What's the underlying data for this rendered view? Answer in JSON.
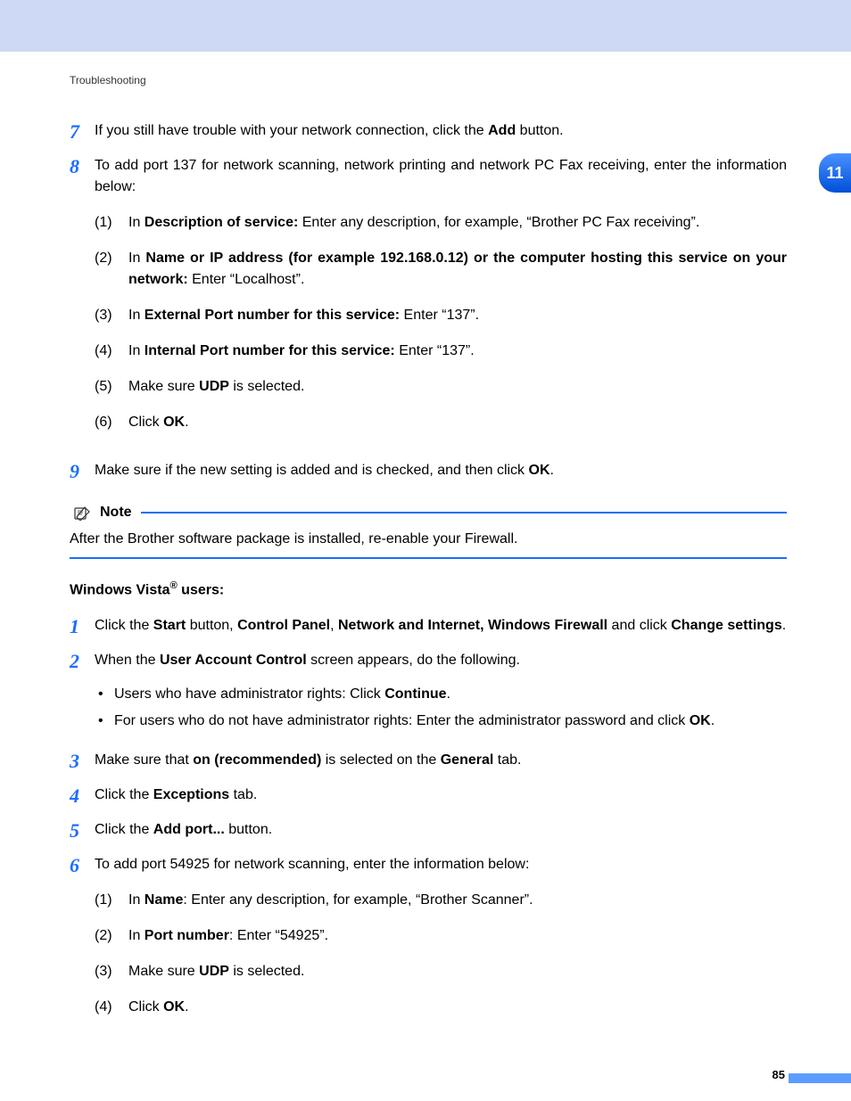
{
  "header": {
    "section": "Troubleshooting"
  },
  "chapter": {
    "number": "11"
  },
  "page": {
    "number": "85"
  },
  "steps7to9": {
    "s7": {
      "num": "7",
      "pre": "If you still have trouble with your network connection, click the ",
      "b1": "Add",
      "post": " button."
    },
    "s8": {
      "num": "8",
      "intro": "To add port 137 for network scanning, network printing and network PC Fax receiving, enter the information below:",
      "items": {
        "i1": {
          "n": "(1)",
          "t1": "In ",
          "b1": "Description of service:",
          "t2": " Enter any description, for example, “Brother PC Fax receiving”."
        },
        "i2": {
          "n": "(2)",
          "t1": "In ",
          "b1": "Name or IP address (for example 192.168.0.12) or the computer hosting this service on your network:",
          "t2": " Enter “Localhost”."
        },
        "i3": {
          "n": "(3)",
          "t1": "In ",
          "b1": "External Port number for this service:",
          "t2": " Enter “137”."
        },
        "i4": {
          "n": "(4)",
          "t1": "In ",
          "b1": "Internal Port number for this service:",
          "t2": " Enter “137”."
        },
        "i5": {
          "n": "(5)",
          "t1": "Make sure ",
          "b1": "UDP",
          "t2": " is selected."
        },
        "i6": {
          "n": "(6)",
          "t1": "Click ",
          "b1": "OK",
          "t2": "."
        }
      }
    },
    "s9": {
      "num": "9",
      "t1": "Make sure if the new setting is added and is checked, and then click ",
      "b1": "OK",
      "t2": "."
    }
  },
  "note": {
    "label": "Note",
    "text": "After the Brother software package is installed, re-enable your Firewall."
  },
  "vista": {
    "heading_pre": "Windows Vista",
    "heading_sup": "®",
    "heading_post": " users:",
    "s1": {
      "num": "1",
      "t1": "Click the ",
      "b1": "Start",
      "t2": " button, ",
      "b2": "Control Panel",
      "t3": ", ",
      "b3": "Network and Internet, Windows Firewall",
      "t4": " and click ",
      "b4": "Change settings",
      "t5": "."
    },
    "s2": {
      "num": "2",
      "t1": "When the ",
      "b1": "User Account Control",
      "t2": " screen appears, do the following.",
      "bullets": {
        "b1": {
          "t1": "Users who have administrator rights: Click ",
          "bold": "Continue",
          "t2": "."
        },
        "b2": {
          "t1": "For users who do not have administrator rights: Enter the administrator password and click ",
          "bold": "OK",
          "t2": "."
        }
      }
    },
    "s3": {
      "num": "3",
      "t1": "Make sure that ",
      "b1": "on (recommended)",
      "t2": " is selected on the ",
      "b2": "General",
      "t3": " tab."
    },
    "s4": {
      "num": "4",
      "t1": "Click the ",
      "b1": "Exceptions",
      "t2": " tab."
    },
    "s5": {
      "num": "5",
      "t1": "Click the ",
      "b1": "Add port...",
      "t2": " button."
    },
    "s6": {
      "num": "6",
      "intro": "To add port 54925 for network scanning, enter the information below:",
      "items": {
        "i1": {
          "n": "(1)",
          "t1": "In ",
          "b1": "Name",
          "t2": ": Enter any description, for example, “Brother Scanner”."
        },
        "i2": {
          "n": "(2)",
          "t1": "In ",
          "b1": "Port number",
          "t2": ": Enter “54925”."
        },
        "i3": {
          "n": "(3)",
          "t1": "Make sure ",
          "b1": "UDP",
          "t2": " is selected."
        },
        "i4": {
          "n": "(4)",
          "t1": "Click ",
          "b1": "OK",
          "t2": "."
        }
      }
    }
  }
}
